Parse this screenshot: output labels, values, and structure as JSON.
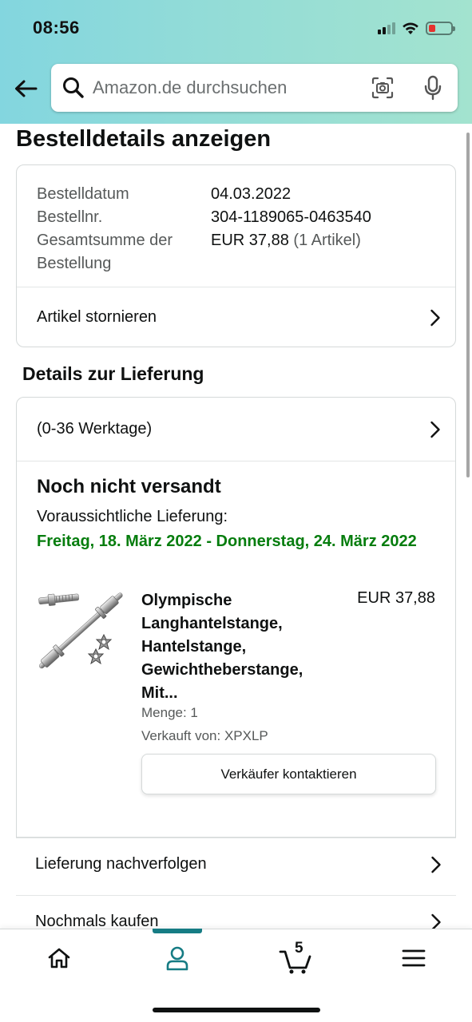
{
  "status_bar": {
    "time": "08:56"
  },
  "search": {
    "placeholder": "Amazon.de durchsuchen"
  },
  "page": {
    "title": "Bestelldetails anzeigen"
  },
  "order_summary": {
    "date_label": "Bestelldatum",
    "date_value": "04.03.2022",
    "number_label": "Bestellnr.",
    "number_value": "304-1189065-0463540",
    "total_label": "Gesamtsumme der Bestellung",
    "total_value": "EUR 37,88",
    "total_count": "(1 Artikel)",
    "cancel_label": "Artikel stornieren"
  },
  "delivery": {
    "section_title": "Details zur Lieferung",
    "window_label": "(0-36 Werktage)",
    "status": "Noch nicht versandt",
    "eta_label": "Voraussichtliche Lieferung:",
    "eta_date": "Freitag, 18. März 2022 - Donnerstag, 24. März 2022",
    "item": {
      "title": "Olympische Langhantelstange, Hantelstange, Gewichtheberstange, Mit...",
      "price": "EUR 37,88",
      "quantity": "Menge: 1",
      "seller": "Verkauft von: XPXLP",
      "contact_button": "Verkäufer kontaktieren"
    }
  },
  "actions": {
    "track": "Lieferung nachverfolgen",
    "buy_again": "Nochmals kaufen"
  },
  "bottom_nav": {
    "cart_count": "5",
    "active_tab": "account",
    "accent_color": "#167c84"
  },
  "colors": {
    "eta_green": "#067d0e",
    "header_gradient_start": "#83d6df",
    "header_gradient_end": "#a3e3cf"
  }
}
